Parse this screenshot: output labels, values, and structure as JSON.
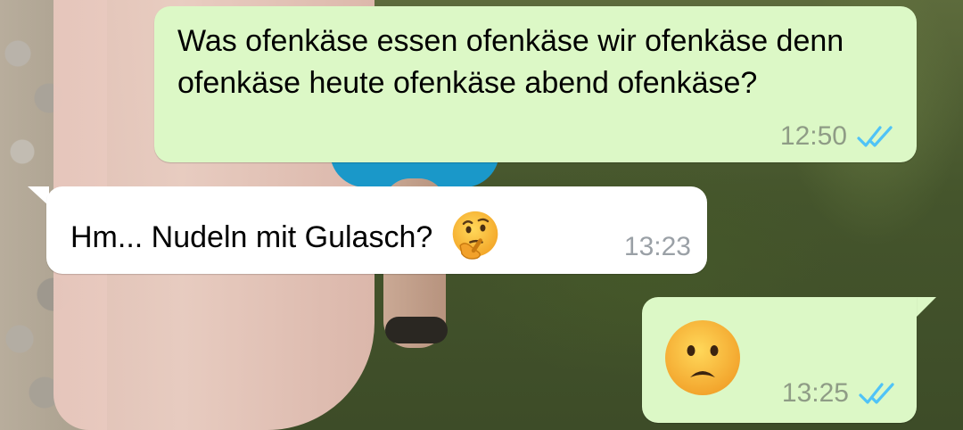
{
  "colors": {
    "outgoing_bubble": "#dcf8c6",
    "incoming_bubble": "#ffffff",
    "read_tick": "#4fc3f7"
  },
  "messages": [
    {
      "direction": "outgoing",
      "text": "Was ofenkäse essen ofenkäse wir ofenkäse denn ofenkäse heute ofenkäse abend ofenkäse?",
      "time": "12:50",
      "status_icon": "double-check-read-icon"
    },
    {
      "direction": "incoming",
      "text": "Hm... Nudeln mit Gulasch?",
      "emoji": "thinking-face-emoji",
      "time": "13:23"
    },
    {
      "direction": "outgoing",
      "emoji": "frowning-face-emoji",
      "time": "13:25",
      "status_icon": "double-check-read-icon"
    }
  ]
}
